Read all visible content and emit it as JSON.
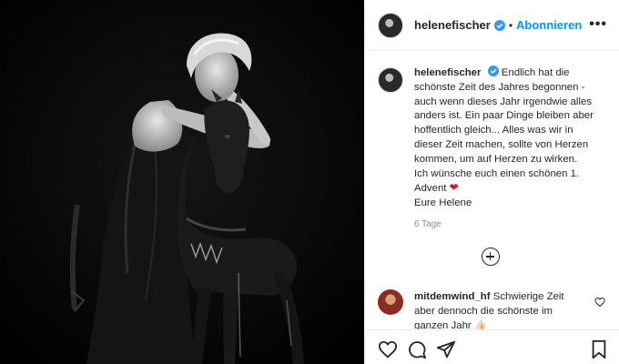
{
  "post": {
    "username": "helenefischer",
    "separator": "•",
    "follow_label": "Abonnieren",
    "more_label": "•••",
    "caption_lines": [
      "Endlich hat die",
      "schönste Zeit des Jahres begonnen -",
      "auch wenn dieses Jahr irgendwie alles",
      "anders ist. Ein paar Dinge bleiben aber",
      "hoffentlich gleich... Alles was wir in",
      "dieser Zeit machen, sollte von Herzen",
      "kommen, um auf Herzen zu wirken.",
      "Ich wünsche euch einen schönen 1.",
      "Advent",
      "Eure Helene"
    ],
    "advent_heart": "❤",
    "age": "6 Tage"
  },
  "comments": [
    {
      "username": "mitdemwind_hf",
      "text_lines": [
        "Schwierige Zeit",
        "aber dennoch die schönste im",
        "ganzen Jahr 👍🏻"
      ]
    }
  ],
  "colors": {
    "accent": "#0095f6",
    "verified": "#3897f0",
    "heart": "#d11a2a",
    "muted": "#8e8e8e",
    "text": "#262626"
  },
  "icons": [
    "verified-badge-icon",
    "more-options-icon",
    "add-comment-icon",
    "like-icon",
    "comment-icon",
    "share-icon",
    "save-icon",
    "comment-like-icon"
  ]
}
